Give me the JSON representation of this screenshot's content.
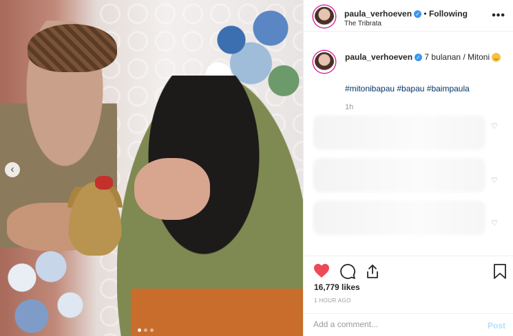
{
  "header": {
    "username": "paula_verhoeven",
    "separator": "•",
    "follow_label": "Following",
    "location": "The Tribrata",
    "more_label": "•••"
  },
  "caption": {
    "username": "paula_verhoeven",
    "text": "7 bulanan / Mitoni",
    "hashtags": "#mitonibapau #bapau #baimpaula",
    "time": "1h"
  },
  "comments": [
    {
      "like_icon": "heart-outline-icon"
    },
    {
      "like_icon": "heart-outline-icon"
    },
    {
      "like_icon": "heart-outline-icon"
    }
  ],
  "actions": {
    "likes": "16,779 likes",
    "time_ago": "1 HOUR AGO",
    "comment_placeholder": "Add a comment...",
    "post_label": "Post"
  },
  "colors": {
    "like_red": "#ed4956",
    "link_blue": "#003569",
    "verified_blue": "#3897f0",
    "post_disabled": "#b2dffc"
  },
  "icons": [
    "verified-badge-icon",
    "heart-filled-icon",
    "comment-icon",
    "share-icon",
    "bookmark-icon",
    "chevron-left-icon",
    "grin-emoji-icon"
  ]
}
